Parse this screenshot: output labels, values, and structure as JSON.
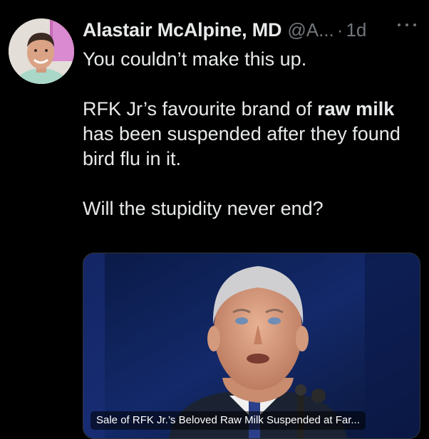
{
  "tweet": {
    "author": {
      "name": "Alastair McAlpine, MD",
      "handle": "@A...",
      "separator": "·",
      "time": "1d",
      "avatar_icon": "profile-photo"
    },
    "more_icon": "more-horizontal-icon",
    "text": {
      "line1": "You couldn’t make this up.",
      "p2_part1": "RFK Jr’s favourite brand of ",
      "p2_bold1": "raw milk",
      "p2_part2": " has been suspended after they found bird flu in it.",
      "line3": "Will the stupidity never end?"
    },
    "link_card": {
      "caption": "Sale of RFK Jr.’s Beloved Raw Milk Suspended at Far...",
      "image_icon": "news-photo"
    }
  },
  "colors": {
    "background": "#000000",
    "text_primary": "#e7e9ea",
    "text_secondary": "#71767b",
    "card_border": "#2f3336"
  }
}
